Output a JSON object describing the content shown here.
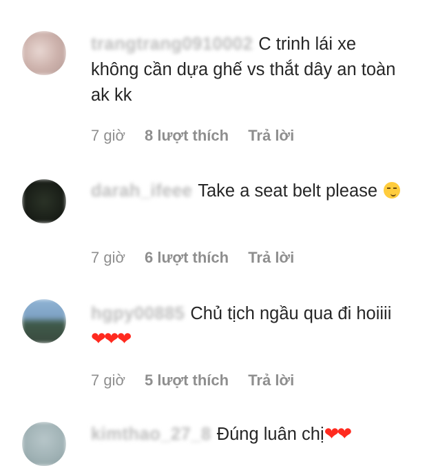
{
  "comments": [
    {
      "username": "trangtrang0910002",
      "text": "C trinh lái xe không cần dựa ghế vs thắt dây an toàn ak kk",
      "emoji": "",
      "time": "7 giờ",
      "likes": "8 lượt thích",
      "reply": "Trả lời"
    },
    {
      "username": "darah_ifeee",
      "text": "Take a seat belt please",
      "emoji": "smirking-face",
      "time": "7 giờ",
      "likes": "6 lượt thích",
      "reply": "Trả lời"
    },
    {
      "username": "hgpy00885",
      "text": "Chủ tịch ngầu qua đi hoiiii",
      "hearts": "❤❤❤",
      "time": "7 giờ",
      "likes": "5 lượt thích",
      "reply": "Trả lời"
    },
    {
      "username": "kimthao_27_8",
      "text": "Đúng luân chị",
      "hearts": "❤❤"
    }
  ],
  "colors": {
    "text": "#262626",
    "meta": "#8e8e8e",
    "heart": "#ff2a1f",
    "background": "#ffffff"
  }
}
